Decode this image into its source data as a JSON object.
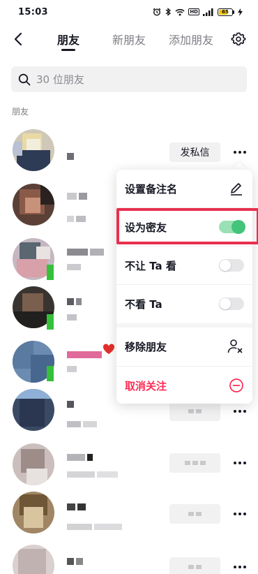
{
  "status_bar": {
    "time": "15:03",
    "battery": "65"
  },
  "header": {
    "tabs": [
      {
        "label": "朋友",
        "active": true
      },
      {
        "label": "新朋友",
        "active": false
      },
      {
        "label": "添加朋友",
        "active": false
      }
    ]
  },
  "search": {
    "placeholder": "30 位朋友"
  },
  "section": {
    "label": "朋友"
  },
  "friend_list": {
    "first_row_button": "发私信"
  },
  "popup_menu": {
    "items": [
      {
        "label": "设置备注名",
        "control": "edit-icon"
      },
      {
        "label": "设为密友",
        "control": "toggle",
        "toggle_on": true
      },
      {
        "label": "不让 Ta 看",
        "control": "toggle",
        "toggle_on": false
      },
      {
        "label": "不看 Ta",
        "control": "toggle",
        "toggle_on": false
      },
      {
        "label": "移除朋友",
        "control": "remove-user-icon"
      },
      {
        "label": "取消关注",
        "control": "minus-circle-icon"
      }
    ]
  },
  "colors": {
    "accent_red": "#fe2c55",
    "toggle_green": "#42c47a",
    "highlight": "#e8304e"
  }
}
